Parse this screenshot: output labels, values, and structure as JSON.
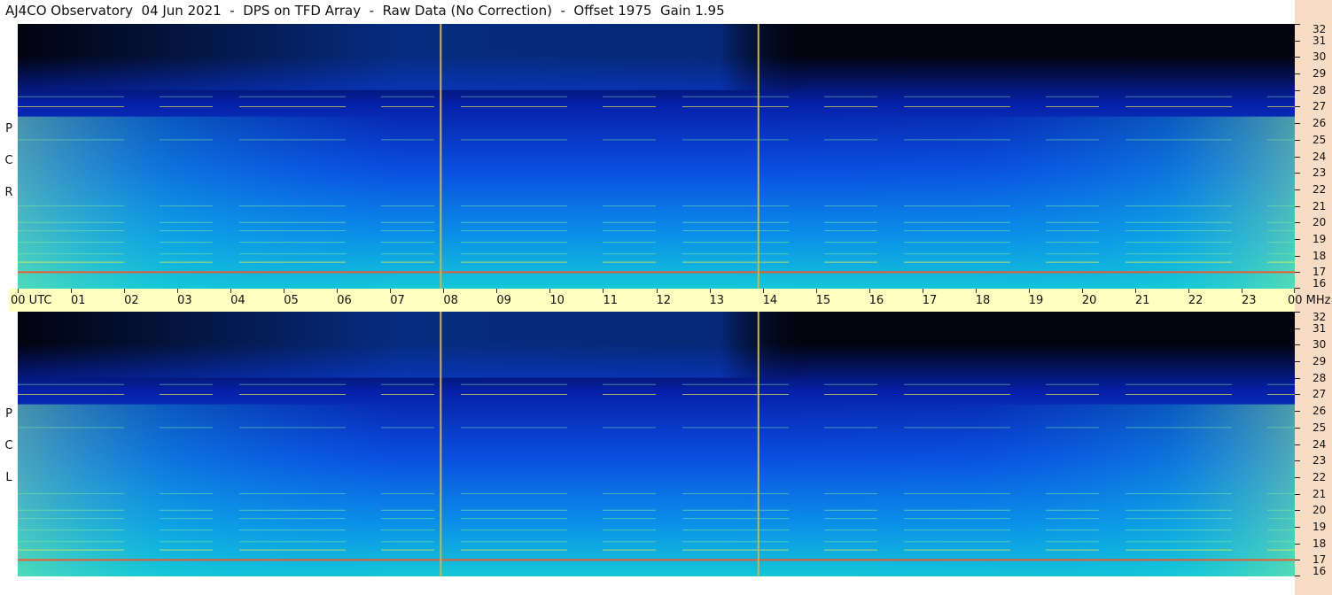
{
  "title": "AJ4CO Observatory  04 Jun 2021  -  DPS on TFD Array  -  Raw Data (No Correction)  -  Offset 1975  Gain 1.95",
  "colors": {
    "background": "#ffffff",
    "time_bar": "#ffffc0",
    "freq_strip": "#f6dcc4",
    "marker_line": "#c8b64a",
    "colormap": [
      "#02030e",
      "#0620a8",
      "#0a4ee0",
      "#0a90e8",
      "#14c8d8",
      "#7ee8a0",
      "#fff040",
      "#ff5020"
    ]
  },
  "chart_data": {
    "type": "heatmap",
    "title": "AJ4CO Observatory  04 Jun 2021  -  DPS on TFD Array  -  Raw Data (No Correction)  -  Offset 1975  Gain 1.95",
    "x_axis": {
      "ticks": [
        "00",
        "01",
        "02",
        "03",
        "04",
        "05",
        "06",
        "07",
        "08",
        "09",
        "10",
        "11",
        "12",
        "13",
        "14",
        "15",
        "16",
        "17",
        "18",
        "19",
        "20",
        "21",
        "22",
        "23",
        "00"
      ],
      "first_label_suffix": "UTC",
      "last_label_suffix": "MHz",
      "range": [
        0,
        24
      ]
    },
    "y_axis": {
      "ticks": [
        "16",
        "17",
        "18",
        "19",
        "20",
        "21",
        "22",
        "23",
        "24",
        "25",
        "26",
        "27",
        "28",
        "29",
        "30",
        "31",
        "32"
      ],
      "range": [
        16,
        32
      ]
    },
    "panels": [
      {
        "name": "RCP",
        "letters": [
          "P",
          "C",
          "R"
        ]
      },
      {
        "name": "LCP",
        "letters": [
          "P",
          "C",
          "L"
        ]
      }
    ],
    "vertical_markers_utc": [
      7.95,
      13.92
    ],
    "band_lines_mhz": [
      {
        "freq": 17.0,
        "strength": 1.0
      },
      {
        "freq": 17.6,
        "strength": 0.6
      },
      {
        "freq": 18.1,
        "strength": 0.4
      },
      {
        "freq": 18.8,
        "strength": 0.45
      },
      {
        "freq": 19.5,
        "strength": 0.35
      },
      {
        "freq": 20.0,
        "strength": 0.5
      },
      {
        "freq": 21.0,
        "strength": 0.35
      },
      {
        "freq": 25.0,
        "strength": 0.3
      },
      {
        "freq": 27.0,
        "strength": 0.55
      },
      {
        "freq": 27.6,
        "strength": 0.3
      }
    ]
  }
}
